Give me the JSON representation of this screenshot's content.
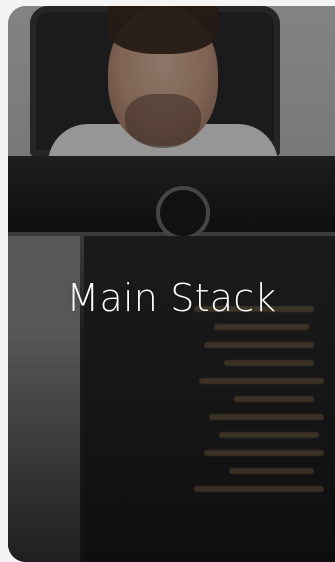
{
  "card": {
    "title": "Main Stack"
  },
  "colors": {
    "card_text": "#ffffff",
    "overlay": "rgba(0,0,0,0.35)",
    "page_background": "#f4f4f4"
  },
  "icons": {
    "monitor_logo": "dell-logo-icon"
  }
}
